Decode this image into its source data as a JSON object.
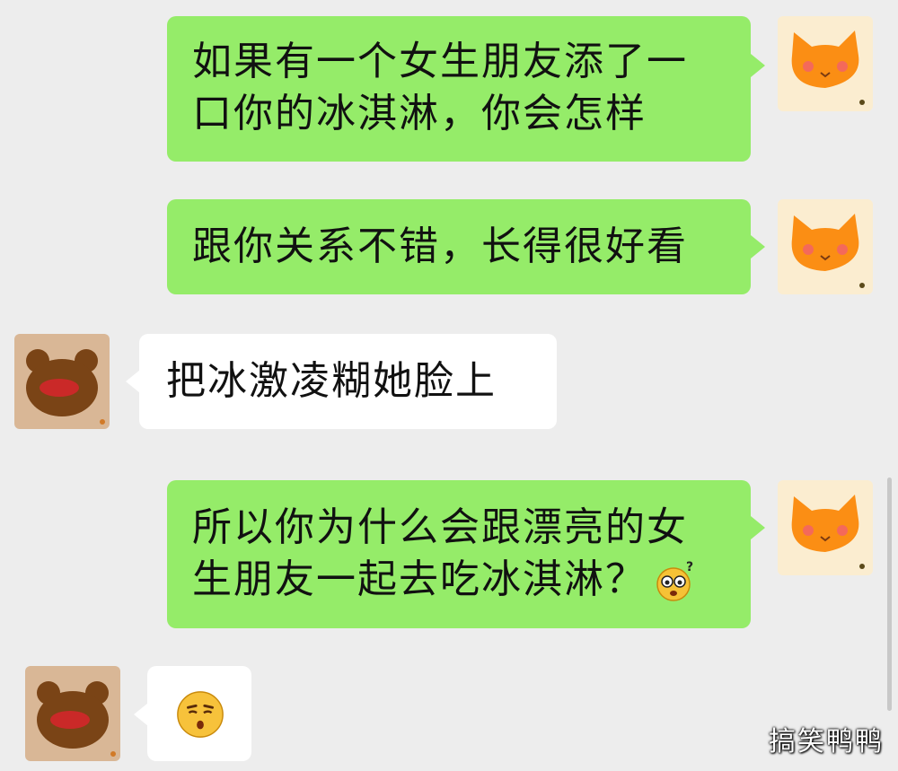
{
  "messages": [
    {
      "side": "right",
      "text": "如果有一个女生朋友添了一口你的冰淇淋，你会怎样",
      "line1": "如果有一个女生朋友添了一",
      "line2": "口你的冰淇淋，你会怎样"
    },
    {
      "side": "right",
      "text": "跟你关系不错，长得很好看"
    },
    {
      "side": "left",
      "text": "把冰激凌糊她脸上"
    },
    {
      "side": "right",
      "line1": "所以你为什么会跟漂亮的女",
      "line2": "生朋友一起去吃冰淇淋？",
      "emoji": "confused-face-emoji"
    },
    {
      "side": "left",
      "emoji": "pouting-face-emoji"
    }
  ],
  "avatars": {
    "self": "cat-avatar",
    "other": "bear-avatar"
  },
  "colors": {
    "sent_bubble": "#95ec69",
    "received_bubble": "#ffffff",
    "background": "#ededed"
  },
  "watermark": "搞笑鸭鸭"
}
